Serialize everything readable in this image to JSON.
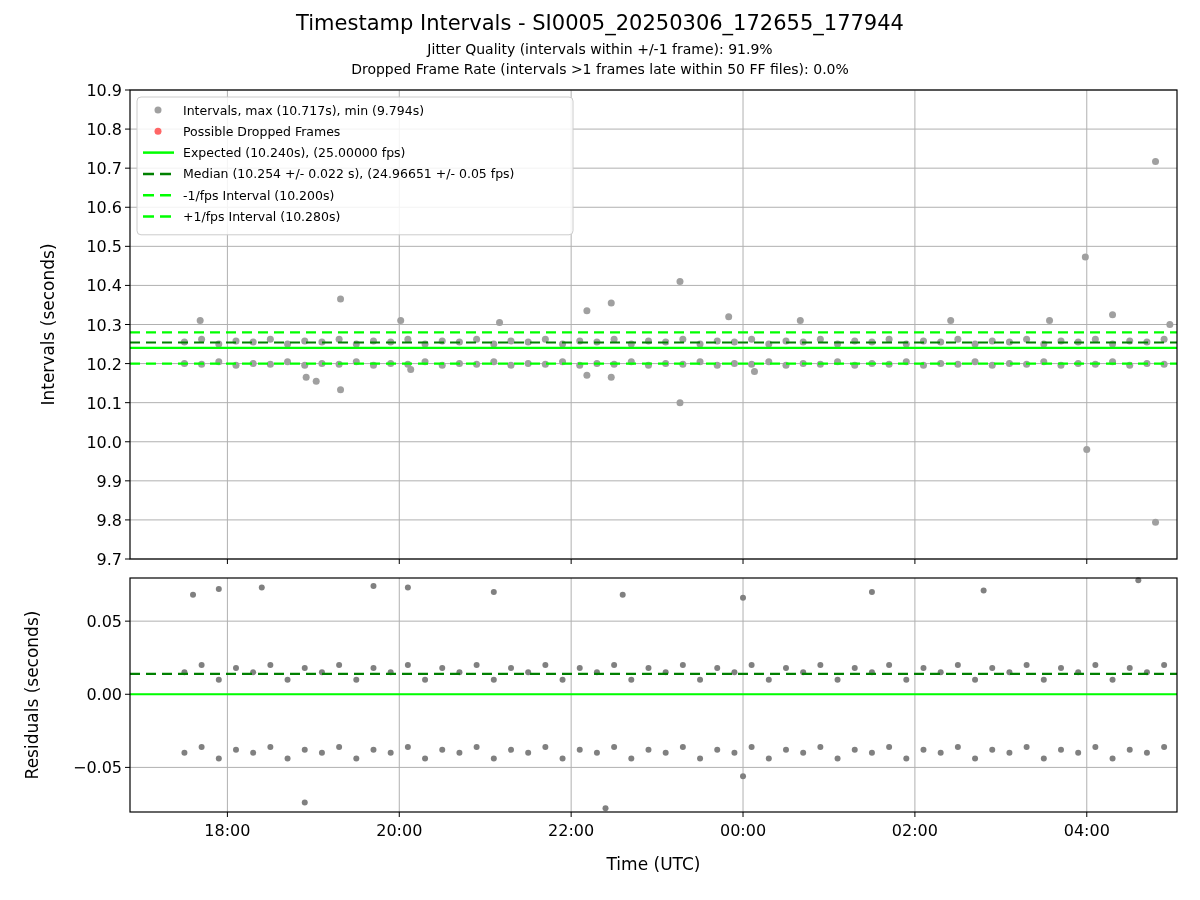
{
  "title": "Timestamp Intervals - SI0005_20250306_172655_177944",
  "subtitles": [
    "Jitter Quality (intervals within +/-1 frame): 91.9%",
    "Dropped Frame Rate (intervals >1 frames late within 50 FF files): 0.0%"
  ],
  "charts": [
    {
      "chart_data": {
        "type": "scatter",
        "ylabel": "Intervals (seconds)",
        "grid": true,
        "xlim": [
          "2025-03-06T16:52",
          "2025-03-07T05:03"
        ],
        "ylim": [
          9.7,
          10.9
        ],
        "yticks": [
          {
            "value": 9.7,
            "label": "9.7"
          },
          {
            "value": 9.8,
            "label": "9.8"
          },
          {
            "value": 9.9,
            "label": "9.9"
          },
          {
            "value": 10.0,
            "label": "10.0"
          },
          {
            "value": 10.1,
            "label": "10.1"
          },
          {
            "value": 10.2,
            "label": "10.2"
          },
          {
            "value": 10.3,
            "label": "10.3"
          },
          {
            "value": 10.4,
            "label": "10.4"
          },
          {
            "value": 10.5,
            "label": "10.5"
          },
          {
            "value": 10.6,
            "label": "10.6"
          },
          {
            "value": 10.7,
            "label": "10.7"
          },
          {
            "value": 10.8,
            "label": "10.8"
          },
          {
            "value": 10.9,
            "label": "10.9"
          }
        ],
        "series": [
          {
            "name": "Intervals, max (10.717s), min (9.794s)",
            "color": "#a0a0a0",
            "x": [
              "2025-03-06T17:30",
              "2025-03-06T17:30",
              "2025-03-06T17:42",
              "2025-03-06T17:42",
              "2025-03-06T17:54",
              "2025-03-06T17:54",
              "2025-03-06T18:06",
              "2025-03-06T18:06",
              "2025-03-06T18:18",
              "2025-03-06T18:18",
              "2025-03-06T18:30",
              "2025-03-06T18:30",
              "2025-03-06T18:42",
              "2025-03-06T18:42",
              "2025-03-06T18:54",
              "2025-03-06T18:54",
              "2025-03-06T19:06",
              "2025-03-06T19:06",
              "2025-03-06T19:18",
              "2025-03-06T19:18",
              "2025-03-06T19:30",
              "2025-03-06T19:30",
              "2025-03-06T19:42",
              "2025-03-06T19:42",
              "2025-03-06T19:54",
              "2025-03-06T19:54",
              "2025-03-06T20:06",
              "2025-03-06T20:06",
              "2025-03-06T20:18",
              "2025-03-06T20:18",
              "2025-03-06T20:30",
              "2025-03-06T20:30",
              "2025-03-06T20:42",
              "2025-03-06T20:42",
              "2025-03-06T20:54",
              "2025-03-06T20:54",
              "2025-03-06T21:06",
              "2025-03-06T21:06",
              "2025-03-06T21:18",
              "2025-03-06T21:18",
              "2025-03-06T21:30",
              "2025-03-06T21:30",
              "2025-03-06T21:42",
              "2025-03-06T21:42",
              "2025-03-06T21:54",
              "2025-03-06T21:54",
              "2025-03-06T22:06",
              "2025-03-06T22:06",
              "2025-03-06T22:18",
              "2025-03-06T22:18",
              "2025-03-06T22:30",
              "2025-03-06T22:30",
              "2025-03-06T22:42",
              "2025-03-06T22:42",
              "2025-03-06T22:54",
              "2025-03-06T22:54",
              "2025-03-06T23:06",
              "2025-03-06T23:06",
              "2025-03-06T23:18",
              "2025-03-06T23:18",
              "2025-03-06T23:30",
              "2025-03-06T23:30",
              "2025-03-06T23:42",
              "2025-03-06T23:42",
              "2025-03-06T23:54",
              "2025-03-06T23:54",
              "2025-03-07T00:06",
              "2025-03-07T00:06",
              "2025-03-07T00:18",
              "2025-03-07T00:18",
              "2025-03-07T00:30",
              "2025-03-07T00:30",
              "2025-03-07T00:42",
              "2025-03-07T00:42",
              "2025-03-07T00:54",
              "2025-03-07T00:54",
              "2025-03-07T01:06",
              "2025-03-07T01:06",
              "2025-03-07T01:18",
              "2025-03-07T01:18",
              "2025-03-07T01:30",
              "2025-03-07T01:30",
              "2025-03-07T01:42",
              "2025-03-07T01:42",
              "2025-03-07T01:54",
              "2025-03-07T01:54",
              "2025-03-07T02:06",
              "2025-03-07T02:06",
              "2025-03-07T02:18",
              "2025-03-07T02:18",
              "2025-03-07T02:30",
              "2025-03-07T02:30",
              "2025-03-07T02:42",
              "2025-03-07T02:42",
              "2025-03-07T02:54",
              "2025-03-07T02:54",
              "2025-03-07T03:06",
              "2025-03-07T03:06",
              "2025-03-07T03:18",
              "2025-03-07T03:18",
              "2025-03-07T03:30",
              "2025-03-07T03:30",
              "2025-03-07T03:42",
              "2025-03-07T03:42",
              "2025-03-07T03:54",
              "2025-03-07T03:54",
              "2025-03-07T04:06",
              "2025-03-07T04:06",
              "2025-03-07T04:18",
              "2025-03-07T04:18",
              "2025-03-07T04:30",
              "2025-03-07T04:30",
              "2025-03-07T04:42",
              "2025-03-07T04:42",
              "2025-03-07T04:54",
              "2025-03-07T04:54",
              "2025-03-07T04:48",
              "2025-03-07T03:59",
              "2025-03-07T04:00",
              "2025-03-07T04:48",
              "2025-03-06T23:16",
              "2025-03-06T23:16",
              "2025-03-06T19:19",
              "2025-03-06T19:19",
              "2025-03-06T22:28",
              "2025-03-06T22:11",
              "2025-03-06T18:55",
              "2025-03-06T19:02",
              "2025-03-06T17:41",
              "2025-03-06T20:01",
              "2025-03-07T00:40",
              "2025-03-07T02:25",
              "2025-03-07T03:34",
              "2025-03-07T04:18",
              "2025-03-06T23:50",
              "2025-03-06T21:10",
              "2025-03-06T20:08",
              "2025-03-06T22:11",
              "2025-03-06T22:28",
              "2025-03-07T00:08",
              "2025-03-07T04:58"
            ],
            "values": [
              10.255,
              10.2,
              10.262,
              10.198,
              10.25,
              10.205,
              10.258,
              10.196,
              10.255,
              10.2,
              10.262,
              10.198,
              10.25,
              10.205,
              10.258,
              10.196,
              10.255,
              10.2,
              10.262,
              10.198,
              10.25,
              10.205,
              10.258,
              10.196,
              10.255,
              10.2,
              10.262,
              10.198,
              10.25,
              10.205,
              10.258,
              10.196,
              10.255,
              10.2,
              10.262,
              10.198,
              10.25,
              10.205,
              10.258,
              10.196,
              10.255,
              10.2,
              10.262,
              10.198,
              10.25,
              10.205,
              10.258,
              10.196,
              10.255,
              10.2,
              10.262,
              10.198,
              10.25,
              10.205,
              10.258,
              10.196,
              10.255,
              10.2,
              10.262,
              10.198,
              10.25,
              10.205,
              10.258,
              10.196,
              10.255,
              10.2,
              10.262,
              10.198,
              10.25,
              10.205,
              10.258,
              10.196,
              10.255,
              10.2,
              10.262,
              10.198,
              10.25,
              10.205,
              10.258,
              10.196,
              10.255,
              10.2,
              10.262,
              10.198,
              10.25,
              10.205,
              10.258,
              10.196,
              10.255,
              10.2,
              10.262,
              10.198,
              10.25,
              10.205,
              10.258,
              10.196,
              10.255,
              10.2,
              10.262,
              10.198,
              10.25,
              10.205,
              10.258,
              10.196,
              10.255,
              10.2,
              10.262,
              10.198,
              10.25,
              10.205,
              10.258,
              10.196,
              10.255,
              10.2,
              10.262,
              10.198,
              10.717,
              10.473,
              9.98,
              9.794,
              10.41,
              10.1,
              10.365,
              10.133,
              10.355,
              10.335,
              10.165,
              10.155,
              10.31,
              10.31,
              10.31,
              10.31,
              10.31,
              10.325,
              10.32,
              10.305,
              10.185,
              10.17,
              10.165,
              10.18,
              10.3
            ]
          },
          {
            "name": "Possible Dropped Frames",
            "color": "#ff6666"
          }
        ],
        "ref_lines": [
          {
            "axis": "y",
            "value": 10.24,
            "label": "Expected (10.240s), (25.00000 fps)",
            "color": "#00ff00"
          },
          {
            "axis": "y",
            "value": 10.254,
            "label": "Median (10.254 +/- 0.022 s), (24.96651 +/- 0.05 fps)",
            "color": "#008000"
          },
          {
            "axis": "y",
            "value": 10.2,
            "label": "-1/fps Interval (10.200s)",
            "color": "#00ff00"
          },
          {
            "axis": "y",
            "value": 10.28,
            "label": "+1/fps Interval (10.280s)",
            "color": "#00ff00"
          }
        ],
        "legend": true
      }
    },
    {
      "chart_data": {
        "type": "scatter",
        "xlabel": "Time (UTC)",
        "ylabel": "Residuals (seconds)",
        "grid": true,
        "xlim": [
          "2025-03-06T16:52",
          "2025-03-07T05:03"
        ],
        "ylim": [
          -0.0805,
          0.0795
        ],
        "xticks": [
          {
            "value": "2025-03-06T18:00",
            "label": "18:00"
          },
          {
            "value": "2025-03-06T20:00",
            "label": "20:00"
          },
          {
            "value": "2025-03-06T22:00",
            "label": "22:00"
          },
          {
            "value": "2025-03-07T00:00",
            "label": "00:00"
          },
          {
            "value": "2025-03-07T02:00",
            "label": "02:00"
          },
          {
            "value": "2025-03-07T04:00",
            "label": "04:00"
          }
        ],
        "yticks": [
          {
            "value": -0.05,
            "label": "−0.05"
          },
          {
            "value": 0,
            "label": "0.00"
          },
          {
            "value": 0.05,
            "label": "0.05"
          }
        ],
        "series": [
          {
            "color": "#808080",
            "x": [
              "2025-03-06T17:30",
              "2025-03-06T17:30",
              "2025-03-06T17:42",
              "2025-03-06T17:42",
              "2025-03-06T17:54",
              "2025-03-06T17:54",
              "2025-03-06T18:06",
              "2025-03-06T18:06",
              "2025-03-06T18:18",
              "2025-03-06T18:18",
              "2025-03-06T18:30",
              "2025-03-06T18:30",
              "2025-03-06T18:42",
              "2025-03-06T18:42",
              "2025-03-06T18:54",
              "2025-03-06T18:54",
              "2025-03-06T19:06",
              "2025-03-06T19:06",
              "2025-03-06T19:18",
              "2025-03-06T19:18",
              "2025-03-06T19:30",
              "2025-03-06T19:30",
              "2025-03-06T19:42",
              "2025-03-06T19:42",
              "2025-03-06T19:54",
              "2025-03-06T19:54",
              "2025-03-06T20:06",
              "2025-03-06T20:06",
              "2025-03-06T20:18",
              "2025-03-06T20:18",
              "2025-03-06T20:30",
              "2025-03-06T20:30",
              "2025-03-06T20:42",
              "2025-03-06T20:42",
              "2025-03-06T20:54",
              "2025-03-06T20:54",
              "2025-03-06T21:06",
              "2025-03-06T21:06",
              "2025-03-06T21:18",
              "2025-03-06T21:18",
              "2025-03-06T21:30",
              "2025-03-06T21:30",
              "2025-03-06T21:42",
              "2025-03-06T21:42",
              "2025-03-06T21:54",
              "2025-03-06T21:54",
              "2025-03-06T22:06",
              "2025-03-06T22:06",
              "2025-03-06T22:18",
              "2025-03-06T22:18",
              "2025-03-06T22:30",
              "2025-03-06T22:30",
              "2025-03-06T22:42",
              "2025-03-06T22:42",
              "2025-03-06T22:54",
              "2025-03-06T22:54",
              "2025-03-06T23:06",
              "2025-03-06T23:06",
              "2025-03-06T23:18",
              "2025-03-06T23:18",
              "2025-03-06T23:30",
              "2025-03-06T23:30",
              "2025-03-06T23:42",
              "2025-03-06T23:42",
              "2025-03-06T23:54",
              "2025-03-06T23:54",
              "2025-03-07T00:06",
              "2025-03-07T00:06",
              "2025-03-07T00:18",
              "2025-03-07T00:18",
              "2025-03-07T00:30",
              "2025-03-07T00:30",
              "2025-03-07T00:42",
              "2025-03-07T00:42",
              "2025-03-07T00:54",
              "2025-03-07T00:54",
              "2025-03-07T01:06",
              "2025-03-07T01:06",
              "2025-03-07T01:18",
              "2025-03-07T01:18",
              "2025-03-07T01:30",
              "2025-03-07T01:30",
              "2025-03-07T01:42",
              "2025-03-07T01:42",
              "2025-03-07T01:54",
              "2025-03-07T01:54",
              "2025-03-07T02:06",
              "2025-03-07T02:06",
              "2025-03-07T02:18",
              "2025-03-07T02:18",
              "2025-03-07T02:30",
              "2025-03-07T02:30",
              "2025-03-07T02:42",
              "2025-03-07T02:42",
              "2025-03-07T02:54",
              "2025-03-07T02:54",
              "2025-03-07T03:06",
              "2025-03-07T03:06",
              "2025-03-07T03:18",
              "2025-03-07T03:18",
              "2025-03-07T03:30",
              "2025-03-07T03:30",
              "2025-03-07T03:42",
              "2025-03-07T03:42",
              "2025-03-07T03:54",
              "2025-03-07T03:54",
              "2025-03-07T04:06",
              "2025-03-07T04:06",
              "2025-03-07T04:18",
              "2025-03-07T04:18",
              "2025-03-07T04:30",
              "2025-03-07T04:30",
              "2025-03-07T04:42",
              "2025-03-07T04:42",
              "2025-03-07T04:54",
              "2025-03-07T04:54",
              "2025-03-06T17:36",
              "2025-03-06T17:54",
              "2025-03-06T18:24",
              "2025-03-06T19:42",
              "2025-03-06T20:06",
              "2025-03-06T21:06",
              "2025-03-06T22:36",
              "2025-03-07T00:00",
              "2025-03-07T01:30",
              "2025-03-07T02:48",
              "2025-03-07T04:36",
              "2025-03-06T18:54",
              "2025-03-06T22:24",
              "2025-03-07T00:00"
            ],
            "values": [
              0.015,
              -0.04,
              0.02,
              -0.036,
              0.01,
              -0.044,
              0.018,
              -0.038,
              0.015,
              -0.04,
              0.02,
              -0.036,
              0.01,
              -0.044,
              0.018,
              -0.038,
              0.015,
              -0.04,
              0.02,
              -0.036,
              0.01,
              -0.044,
              0.018,
              -0.038,
              0.015,
              -0.04,
              0.02,
              -0.036,
              0.01,
              -0.044,
              0.018,
              -0.038,
              0.015,
              -0.04,
              0.02,
              -0.036,
              0.01,
              -0.044,
              0.018,
              -0.038,
              0.015,
              -0.04,
              0.02,
              -0.036,
              0.01,
              -0.044,
              0.018,
              -0.038,
              0.015,
              -0.04,
              0.02,
              -0.036,
              0.01,
              -0.044,
              0.018,
              -0.038,
              0.015,
              -0.04,
              0.02,
              -0.036,
              0.01,
              -0.044,
              0.018,
              -0.038,
              0.015,
              -0.04,
              0.02,
              -0.036,
              0.01,
              -0.044,
              0.018,
              -0.038,
              0.015,
              -0.04,
              0.02,
              -0.036,
              0.01,
              -0.044,
              0.018,
              -0.038,
              0.015,
              -0.04,
              0.02,
              -0.036,
              0.01,
              -0.044,
              0.018,
              -0.038,
              0.015,
              -0.04,
              0.02,
              -0.036,
              0.01,
              -0.044,
              0.018,
              -0.038,
              0.015,
              -0.04,
              0.02,
              -0.036,
              0.01,
              -0.044,
              0.018,
              -0.038,
              0.015,
              -0.04,
              0.02,
              -0.036,
              0.01,
              -0.044,
              0.018,
              -0.038,
              0.015,
              -0.04,
              0.02,
              -0.036,
              0.068,
              0.072,
              0.073,
              0.074,
              0.073,
              0.07,
              0.068,
              0.066,
              0.07,
              0.071,
              0.078,
              -0.074,
              -0.078,
              -0.056
            ]
          }
        ],
        "ref_lines": [
          {
            "axis": "y",
            "value": 0.0,
            "color": "#00ff00"
          },
          {
            "axis": "y",
            "value": 0.014,
            "color": "#008000"
          }
        ]
      }
    }
  ]
}
